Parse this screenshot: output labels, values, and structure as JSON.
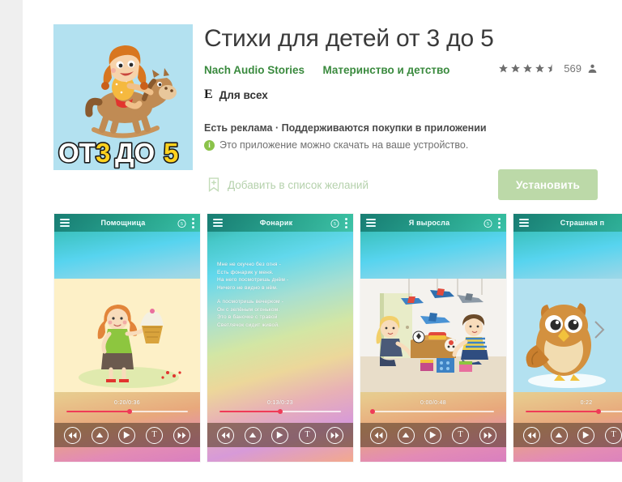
{
  "app": {
    "title": "Стихи для детей от 3 до 5",
    "developer": "Nach Audio Stories",
    "category": "Материнство и детство",
    "rating_stars": 4.5,
    "rating_count": "569",
    "content_rating_badge": "E",
    "content_rating_label": "Для всех",
    "ads_line": "Есть реклама · Поддерживаются покупки в приложении",
    "availability": "Это приложение можно скачать на ваше устройство.",
    "wishlist_label": "Добавить в список желаний",
    "install_label": "Установить",
    "icon_text": "ОТ 3 ДО 5"
  },
  "colors": {
    "link_green": "#3a8a3e",
    "install_bg": "#bcd9a8",
    "info_green": "#8bc34a",
    "seek_red": "#ef3b57",
    "page_bg": "#efefef",
    "card_bg": "#ffffff",
    "icon_bg": "#b3e1f0"
  },
  "icons": {
    "star": "star-icon",
    "half_star": "half-star-icon",
    "person": "person-icon",
    "info": "info-icon",
    "bookmark_add": "bookmark-add-icon",
    "hamburger": "hamburger-icon",
    "timer": "timer-icon",
    "kebab": "kebab-menu-icon",
    "rewind": "rewind-icon",
    "stop": "stop-triangle-icon",
    "play": "play-icon",
    "text": "text-toggle-icon",
    "forward": "fast-forward-icon",
    "next": "chevron-right-icon"
  },
  "screenshots": [
    {
      "title": "Помощница",
      "time": "0:20/0:36",
      "progress": 52,
      "illustration": "girl-with-cupcake",
      "poem": null
    },
    {
      "title": "Фонарик",
      "time": "0:13/0:23",
      "progress": 50,
      "illustration": "none",
      "poem": [
        "Мне не скучно без огня -\nЕсть фонарик у меня.\nНа него посмотришь днём -\nНичего не видно в нём.",
        "А посмотришь вечерком -\nОн с зелёным огоньком.\nЭто в баночке с травой\nСветлячок сидит живой."
      ]
    },
    {
      "title": "Я выросла",
      "time": "0:00/0:48",
      "progress": 0,
      "illustration": "kids-with-toys",
      "poem": null
    },
    {
      "title": "Страшная п",
      "time": "0:22",
      "progress": 60,
      "illustration": "owl",
      "poem": null
    }
  ]
}
